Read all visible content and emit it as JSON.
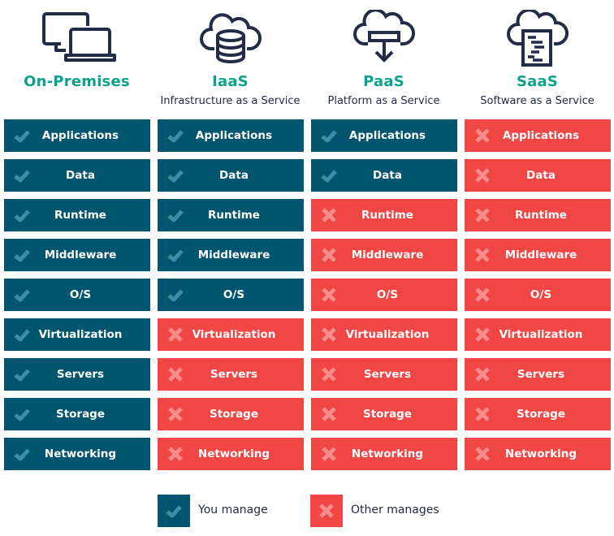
{
  "colors": {
    "you_manage": "#02556f",
    "other_manages": "#f04745",
    "check_mark": "#3d8ea2",
    "cross_mark": "#f78c8a",
    "title_accent": "#0aa38a",
    "icon_stroke": "#232c47"
  },
  "columns": [
    {
      "key": "onprem",
      "title": "On-Premises",
      "subtitle": "",
      "icon": "desktop-laptop-icon"
    },
    {
      "key": "iaas",
      "title": "IaaS",
      "subtitle": "Infrastructure as a Service",
      "icon": "cloud-database-icon"
    },
    {
      "key": "paas",
      "title": "PaaS",
      "subtitle": "Platform as a Service",
      "icon": "cloud-download-icon"
    },
    {
      "key": "saas",
      "title": "SaaS",
      "subtitle": "Software as a Service",
      "icon": "cloud-document-icon"
    }
  ],
  "layers": [
    "Applications",
    "Data",
    "Runtime",
    "Middleware",
    "O/S",
    "Virtualization",
    "Servers",
    "Storage",
    "Networking"
  ],
  "managed_by_you": {
    "onprem": [
      true,
      true,
      true,
      true,
      true,
      true,
      true,
      true,
      true
    ],
    "iaas": [
      true,
      true,
      true,
      true,
      true,
      false,
      false,
      false,
      false
    ],
    "paas": [
      true,
      true,
      false,
      false,
      false,
      false,
      false,
      false,
      false
    ],
    "saas": [
      false,
      false,
      false,
      false,
      false,
      false,
      false,
      false,
      false
    ]
  },
  "legend": {
    "you_manage": "You manage",
    "other_manages": "Other manages"
  }
}
